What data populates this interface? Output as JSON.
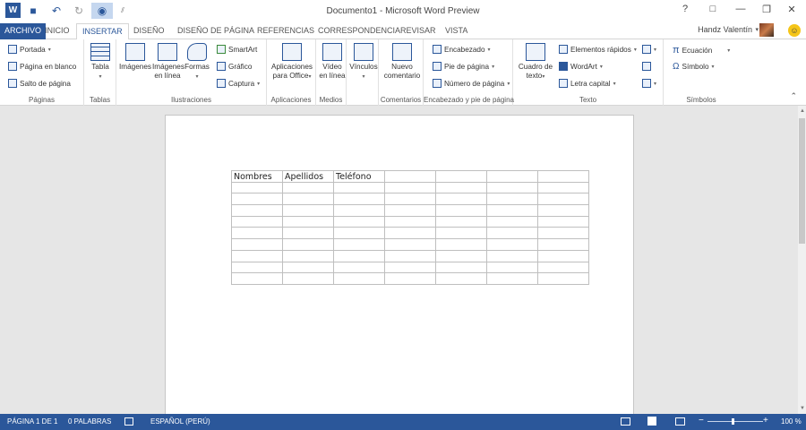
{
  "window": {
    "title": "Documento1 - Microsoft Word Preview",
    "help": "?",
    "minimize": "—",
    "restore": "❐",
    "close": "✕"
  },
  "qat": {
    "logo": "W",
    "save": "💾",
    "undo": "↶",
    "redo": "↻",
    "touch": "◉",
    "customize": "⫽"
  },
  "tabs": [
    "ARCHIVO",
    "INICIO",
    "INSERTAR",
    "DISEÑO",
    "DISEÑO DE PÁGINA",
    "REFERENCIAS",
    "CORRESPONDENCIA",
    "REVISAR",
    "VISTA"
  ],
  "user": {
    "name": "Handz Valentín",
    "dropdown": "▾",
    "emoji": "☺"
  },
  "ribbon": {
    "paginas": {
      "label": "Páginas",
      "items": [
        "Portada",
        "Página en blanco",
        "Salto de página"
      ]
    },
    "tablas": {
      "label": "Tablas",
      "tabla": "Tabla"
    },
    "ilustraciones": {
      "label": "Ilustraciones",
      "imagenes": "Imágenes",
      "imagenes_linea_1": "Imágenes",
      "imagenes_linea_2": "en línea",
      "formas": "Formas",
      "smartart": "SmartArt",
      "grafico": "Gráfico",
      "captura": "Captura"
    },
    "aplicaciones": {
      "label": "Aplicaciones",
      "line1": "Aplicaciones",
      "line2": "para Office"
    },
    "medios": {
      "label": "Medios",
      "line1": "Vídeo",
      "line2": "en línea"
    },
    "vinculos": {
      "label": "Vínculos"
    },
    "comentarios": {
      "label": "Comentarios",
      "line1": "Nuevo",
      "line2": "comentario"
    },
    "encabezado": {
      "label": "Encabezado y pie de página",
      "items": [
        "Encabezado",
        "Pie de página",
        "Número de página"
      ]
    },
    "texto": {
      "label": "Texto",
      "cuadro1": "Cuadro de",
      "cuadro2": "texto",
      "items": [
        "Elementos rápidos",
        "WordArt",
        "Letra capital"
      ]
    },
    "simbolos": {
      "label": "Símbolos",
      "items": [
        "Ecuación",
        "Símbolo"
      ]
    }
  },
  "document": {
    "table_header": [
      "Nombres",
      "Apellidos",
      "Teléfono",
      "",
      "",
      "",
      "",
      ""
    ],
    "rows": 10,
    "cols": 7
  },
  "status": {
    "page": "PÁGINA 1 DE 1",
    "words": "0 PALABRAS",
    "language": "ESPAÑOL (PERÚ)",
    "zoom_minus": "−",
    "zoom_plus": "+",
    "zoom": "100 %"
  },
  "colors": {
    "accent": "#2b579a"
  }
}
